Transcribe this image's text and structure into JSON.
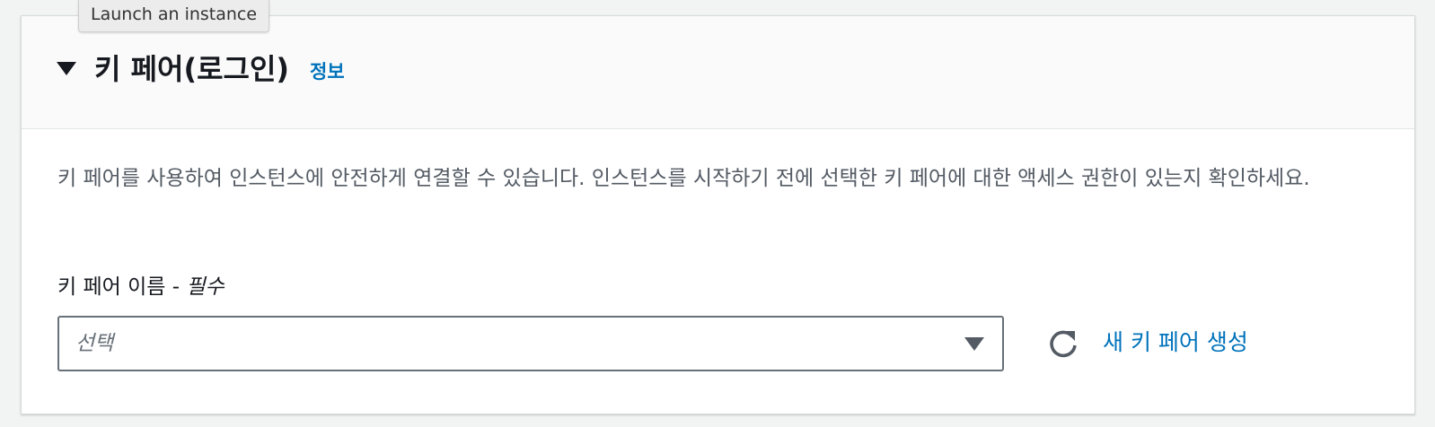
{
  "tooltip": {
    "text": "Launch an instance"
  },
  "section": {
    "title": "키 페어(로그인)",
    "info_link": "정보",
    "description": "키 페어를 사용하여 인스턴스에 안전하게 연결할 수 있습니다. 인스턴스를 시작하기 전에 선택한 키 페어에 대한 액세스 권한이 있는지 확인하세요."
  },
  "key_pair_field": {
    "label": "키 페어 이름 - ",
    "required_text": "필수",
    "placeholder": "선택",
    "selected_value": ""
  },
  "actions": {
    "refresh_icon": "refresh-icon",
    "create_link": "새 키 페어 생성"
  },
  "colors": {
    "link": "#0073bb",
    "text": "#16191f",
    "secondary_text": "#545b64",
    "header_bg": "#fafafa",
    "border": "#687078"
  }
}
